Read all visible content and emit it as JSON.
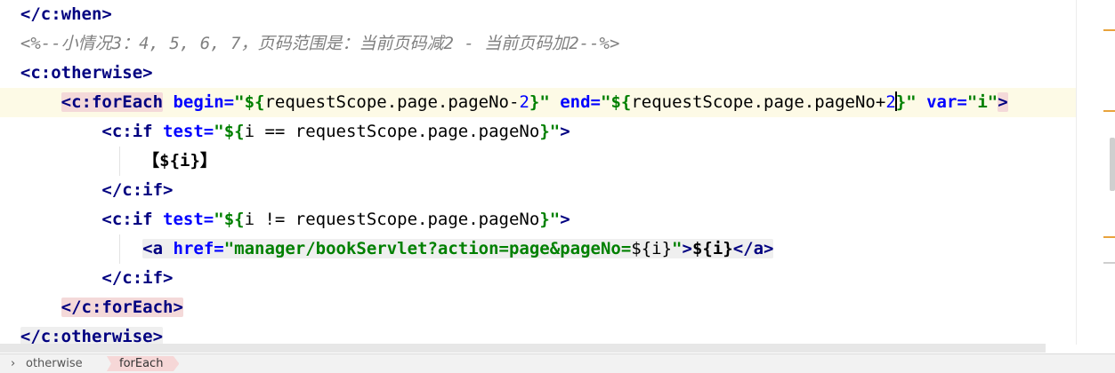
{
  "editor": {
    "lines": {
      "l1": {
        "tag": "</c:when>"
      },
      "l2": {
        "comment": "<%--小情况3：4, 5, 6, 7，页码范围是：当前页码减2 - 当前页码加2--%>"
      },
      "l3": {
        "tag": "<c:otherwise>"
      },
      "l4": {
        "open": "<c:forEach",
        "a1": "begin=",
        "v1a": "\"${",
        "v1b": "requestScope.page.pageNo-",
        "v1n": "2",
        "v1c": "}\"",
        "a2": "end=",
        "v2a": "\"${",
        "v2b": "requestScope.page.pageNo+",
        "v2n": "2",
        "v2c": "}\"",
        "a3": "var=",
        "v3": "\"i\"",
        "close": ">"
      },
      "l5": {
        "open": "<c:if",
        "a1": "test=",
        "v1a": "\"${",
        "v1b": "i == requestScope.page.pageNo",
        "v1c": "}\"",
        "close": ">"
      },
      "l6": {
        "text": "【${i}】"
      },
      "l7": {
        "tag": "</c:if>"
      },
      "l8": {
        "open": "<c:if",
        "a1": "test=",
        "v1a": "\"${",
        "v1b": "i != requestScope.page.pageNo",
        "v1c": "}\"",
        "close": ">"
      },
      "l9": {
        "open": "<a",
        "a1": "href=",
        "v1": "\"manager/bookServlet?action=page&pageNo=",
        "v1el": "${i}",
        "v1end": "\"",
        "close": ">",
        "body": "${i}",
        "end": "</a>"
      },
      "l10": {
        "tag": "</c:if>"
      },
      "l11": {
        "tag": "</c:forEach>"
      },
      "l12": {
        "tag": "</c:otherwise>"
      }
    }
  },
  "breadcrumb": {
    "items": [
      "otherwise",
      "forEach"
    ],
    "chevron": "›"
  }
}
